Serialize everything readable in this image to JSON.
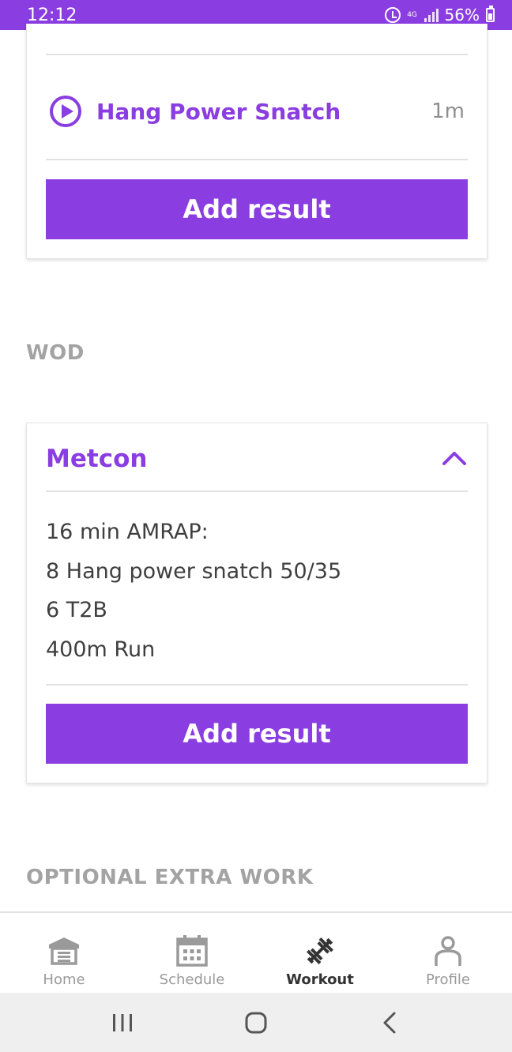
{
  "status_bar": {
    "time": "12:12",
    "network": "4G",
    "battery": "56%"
  },
  "top_card": {
    "movement": {
      "name": "Hang Power Snatch",
      "duration": "1m"
    },
    "add_result_label": "Add result"
  },
  "wod_section": {
    "label": "WOD"
  },
  "metcon_card": {
    "title": "Metcon",
    "lines": [
      "16 min AMRAP:",
      "8 Hang power snatch 50/35",
      "6 T2B",
      "400m Run"
    ],
    "add_result_label": "Add result"
  },
  "optional_section": {
    "label": "OPTIONAL EXTRA WORK"
  },
  "bottom_nav": {
    "items": [
      {
        "label": "Home",
        "icon": "home-icon",
        "active": false
      },
      {
        "label": "Schedule",
        "icon": "calendar-icon",
        "active": false
      },
      {
        "label": "Workout",
        "icon": "dumbbell-icon",
        "active": true
      },
      {
        "label": "Profile",
        "icon": "person-icon",
        "active": false
      }
    ]
  },
  "colors": {
    "accent": "#8a3de0",
    "section_label": "#a3a3a3",
    "body_text": "#3f3f3f",
    "system_nav_bg": "#efefef"
  }
}
